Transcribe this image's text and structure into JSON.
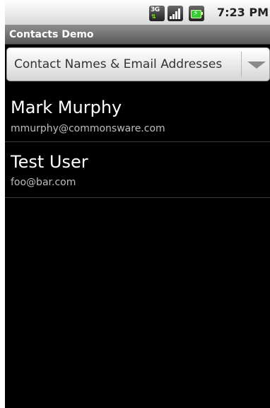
{
  "status_bar": {
    "network_icon": "3g-data-icon",
    "network_label": "3G",
    "signal_icon": "signal-strength-icon",
    "battery_icon": "battery-charging-icon",
    "time": "7:23 PM"
  },
  "app": {
    "title": "Contacts Demo"
  },
  "spinner": {
    "selected": "Contact Names & Email Addresses",
    "arrow_icon": "dropdown-arrow-icon"
  },
  "contacts": [
    {
      "name": "Mark Murphy",
      "email": "mmurphy@commonsware.com"
    },
    {
      "name": "Test User",
      "email": "foo@bar.com"
    }
  ],
  "colors": {
    "background": "#000000",
    "title_bar": "#707070",
    "name_text": "#ffffff",
    "email_text": "#bdbdbd",
    "divider": "#3a3a3a"
  }
}
